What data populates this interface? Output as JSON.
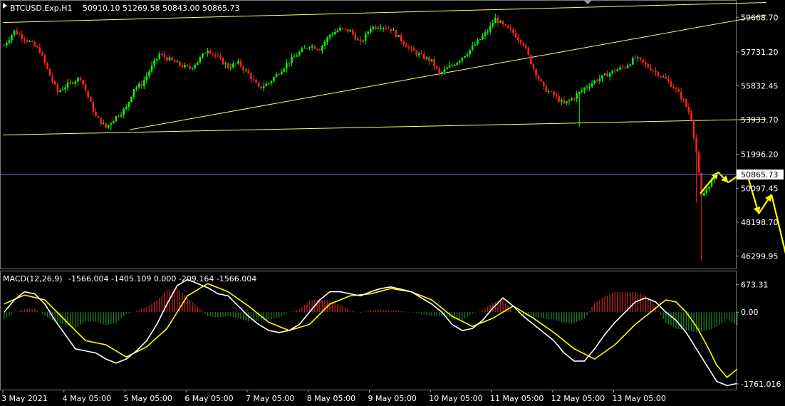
{
  "header": {
    "symbol_label": "BTCUSD.Exp,H1",
    "ohlc_text": "50910.10 51269.58 50843.00 50865.73"
  },
  "macd": {
    "label": "MACD(12,26,9)",
    "values_text": "-1566.004 -1405.109 0.000 -209.164 -1566.004"
  },
  "colors": {
    "background": "#000000",
    "bull": "#00ff00",
    "bear": "#ff2020",
    "trendline": "#ffff66",
    "macd_line": "#ffffff",
    "signal_line": "#ffff00",
    "forecast_arrow": "#ffff00",
    "current_price_line": "#6b7ab8"
  },
  "chart_data": [
    {
      "type": "candlestick",
      "title": "BTCUSD.Exp,H1",
      "ylim": [
        45600,
        60600
      ],
      "yticks": [
        59668.7,
        57731.2,
        55832.45,
        53933.7,
        51996.2,
        50097.45,
        48198.7,
        46299.95
      ],
      "current_price": 50865.73,
      "current_price_label": "50865.73",
      "xticks": [
        "3 May 2021",
        "4 May 05:00",
        "5 May 05:00",
        "6 May 05:00",
        "7 May 05:00",
        "8 May 05:00",
        "9 May 05:00",
        "10 May 05:00",
        "11 May 05:00",
        "12 May 05:00",
        "13 May 05:00"
      ],
      "close_path": [
        [
          0,
          58100
        ],
        [
          4,
          58900
        ],
        [
          9,
          58400
        ],
        [
          14,
          57800
        ],
        [
          18,
          56400
        ],
        [
          21,
          55500
        ],
        [
          25,
          55900
        ],
        [
          30,
          56300
        ],
        [
          33,
          55200
        ],
        [
          36,
          54100
        ],
        [
          40,
          53500
        ],
        [
          44,
          54100
        ],
        [
          48,
          54600
        ],
        [
          51,
          55700
        ],
        [
          54,
          55900
        ],
        [
          58,
          56900
        ],
        [
          61,
          57600
        ],
        [
          65,
          57300
        ],
        [
          69,
          57000
        ],
        [
          73,
          56800
        ],
        [
          76,
          57200
        ],
        [
          80,
          57900
        ],
        [
          84,
          57400
        ],
        [
          88,
          56900
        ],
        [
          92,
          57100
        ],
        [
          96,
          56500
        ],
        [
          100,
          55700
        ],
        [
          104,
          56000
        ],
        [
          108,
          56600
        ],
        [
          112,
          57200
        ],
        [
          116,
          57700
        ],
        [
          120,
          58100
        ],
        [
          124,
          57900
        ],
        [
          128,
          58700
        ],
        [
          132,
          59000
        ],
        [
          136,
          58900
        ],
        [
          140,
          58200
        ],
        [
          144,
          59100
        ],
        [
          148,
          59200
        ],
        [
          152,
          59000
        ],
        [
          156,
          58400
        ],
        [
          160,
          57800
        ],
        [
          164,
          57500
        ],
        [
          168,
          57200
        ],
        [
          171,
          56500
        ],
        [
          174,
          56800
        ],
        [
          178,
          57200
        ],
        [
          182,
          57700
        ],
        [
          186,
          58300
        ],
        [
          190,
          58900
        ],
        [
          193,
          59600
        ],
        [
          196,
          59200
        ],
        [
          200,
          58800
        ],
        [
          204,
          58200
        ],
        [
          208,
          56800
        ],
        [
          212,
          55700
        ],
        [
          216,
          55300
        ],
        [
          220,
          54800
        ],
        [
          224,
          55200
        ],
        [
          228,
          55700
        ],
        [
          232,
          56100
        ],
        [
          236,
          56400
        ],
        [
          240,
          56700
        ],
        [
          244,
          56900
        ],
        [
          248,
          57400
        ],
        [
          252,
          57000
        ],
        [
          256,
          56600
        ],
        [
          260,
          56200
        ],
        [
          264,
          55600
        ],
        [
          267,
          55000
        ],
        [
          270,
          54000
        ],
        [
          272,
          52100
        ],
        [
          274,
          49600
        ],
        [
          277,
          50300
        ],
        [
          280,
          50865.73
        ]
      ],
      "trendlines": [
        {
          "from": [
            0,
            59380
          ],
          "to": [
            300,
            60500
          ]
        },
        {
          "from": [
            50,
            53380
          ],
          "to": [
            300,
            59800
          ]
        },
        {
          "from": [
            0,
            53080
          ],
          "to": [
            300,
            53970
          ]
        }
      ],
      "forecast_path": [
        [
          274,
          49800
        ],
        [
          281,
          51000
        ],
        [
          285,
          50420
        ],
        [
          292,
          51100
        ],
        [
          297,
          48670
        ],
        [
          302,
          49750
        ],
        [
          310,
          46000
        ]
      ]
    },
    {
      "type": "macd",
      "title": "MACD(12,26,9)",
      "ylim": [
        -1900,
        1000
      ],
      "yticks": [
        673.31,
        0.0,
        -1761.016
      ],
      "ytick_labels": [
        "673.31",
        "0.00",
        "-1761.016"
      ],
      "macd_path": [
        [
          0,
          0
        ],
        [
          4,
          300
        ],
        [
          8,
          500
        ],
        [
          12,
          450
        ],
        [
          16,
          200
        ],
        [
          20,
          -200
        ],
        [
          24,
          -550
        ],
        [
          28,
          -900
        ],
        [
          32,
          -950
        ],
        [
          36,
          -1000
        ],
        [
          40,
          -1150
        ],
        [
          44,
          -1250
        ],
        [
          48,
          -1150
        ],
        [
          52,
          -950
        ],
        [
          56,
          -700
        ],
        [
          60,
          -300
        ],
        [
          64,
          200
        ],
        [
          68,
          650
        ],
        [
          72,
          800
        ],
        [
          76,
          700
        ],
        [
          80,
          600
        ],
        [
          84,
          450
        ],
        [
          88,
          400
        ],
        [
          92,
          150
        ],
        [
          96,
          -100
        ],
        [
          100,
          -300
        ],
        [
          104,
          -450
        ],
        [
          108,
          -500
        ],
        [
          112,
          -450
        ],
        [
          116,
          -300
        ],
        [
          120,
          0
        ],
        [
          124,
          300
        ],
        [
          128,
          500
        ],
        [
          132,
          500
        ],
        [
          136,
          450
        ],
        [
          140,
          400
        ],
        [
          144,
          500
        ],
        [
          148,
          580
        ],
        [
          152,
          620
        ],
        [
          156,
          560
        ],
        [
          160,
          500
        ],
        [
          164,
          350
        ],
        [
          168,
          200
        ],
        [
          172,
          0
        ],
        [
          176,
          -300
        ],
        [
          180,
          -450
        ],
        [
          184,
          -400
        ],
        [
          188,
          -200
        ],
        [
          192,
          100
        ],
        [
          196,
          350
        ],
        [
          200,
          150
        ],
        [
          204,
          -100
        ],
        [
          208,
          -300
        ],
        [
          212,
          -500
        ],
        [
          216,
          -700
        ],
        [
          220,
          -1000
        ],
        [
          224,
          -1200
        ],
        [
          228,
          -1200
        ],
        [
          232,
          -900
        ],
        [
          236,
          -550
        ],
        [
          240,
          -250
        ],
        [
          244,
          0
        ],
        [
          248,
          250
        ],
        [
          252,
          350
        ],
        [
          256,
          250
        ],
        [
          260,
          0
        ],
        [
          264,
          -200
        ],
        [
          268,
          -500
        ],
        [
          272,
          -900
        ],
        [
          276,
          -1300
        ],
        [
          280,
          -1700
        ],
        [
          284,
          -1800
        ],
        [
          288,
          -1750
        ]
      ],
      "signal_path": [
        [
          0,
          200
        ],
        [
          8,
          420
        ],
        [
          16,
          300
        ],
        [
          24,
          -200
        ],
        [
          32,
          -700
        ],
        [
          40,
          -800
        ],
        [
          48,
          -1100
        ],
        [
          56,
          -850
        ],
        [
          64,
          -400
        ],
        [
          72,
          400
        ],
        [
          80,
          700
        ],
        [
          88,
          500
        ],
        [
          96,
          150
        ],
        [
          104,
          -250
        ],
        [
          112,
          -450
        ],
        [
          120,
          -300
        ],
        [
          128,
          200
        ],
        [
          136,
          400
        ],
        [
          144,
          450
        ],
        [
          152,
          580
        ],
        [
          160,
          500
        ],
        [
          168,
          300
        ],
        [
          176,
          -100
        ],
        [
          184,
          -350
        ],
        [
          192,
          -150
        ],
        [
          200,
          150
        ],
        [
          208,
          -150
        ],
        [
          216,
          -500
        ],
        [
          224,
          -900
        ],
        [
          232,
          -1150
        ],
        [
          240,
          -800
        ],
        [
          248,
          -300
        ],
        [
          256,
          100
        ],
        [
          260,
          300
        ],
        [
          264,
          250
        ],
        [
          268,
          0
        ],
        [
          272,
          -350
        ],
        [
          276,
          -800
        ],
        [
          280,
          -1300
        ],
        [
          284,
          -1600
        ],
        [
          288,
          -1400
        ]
      ]
    }
  ]
}
